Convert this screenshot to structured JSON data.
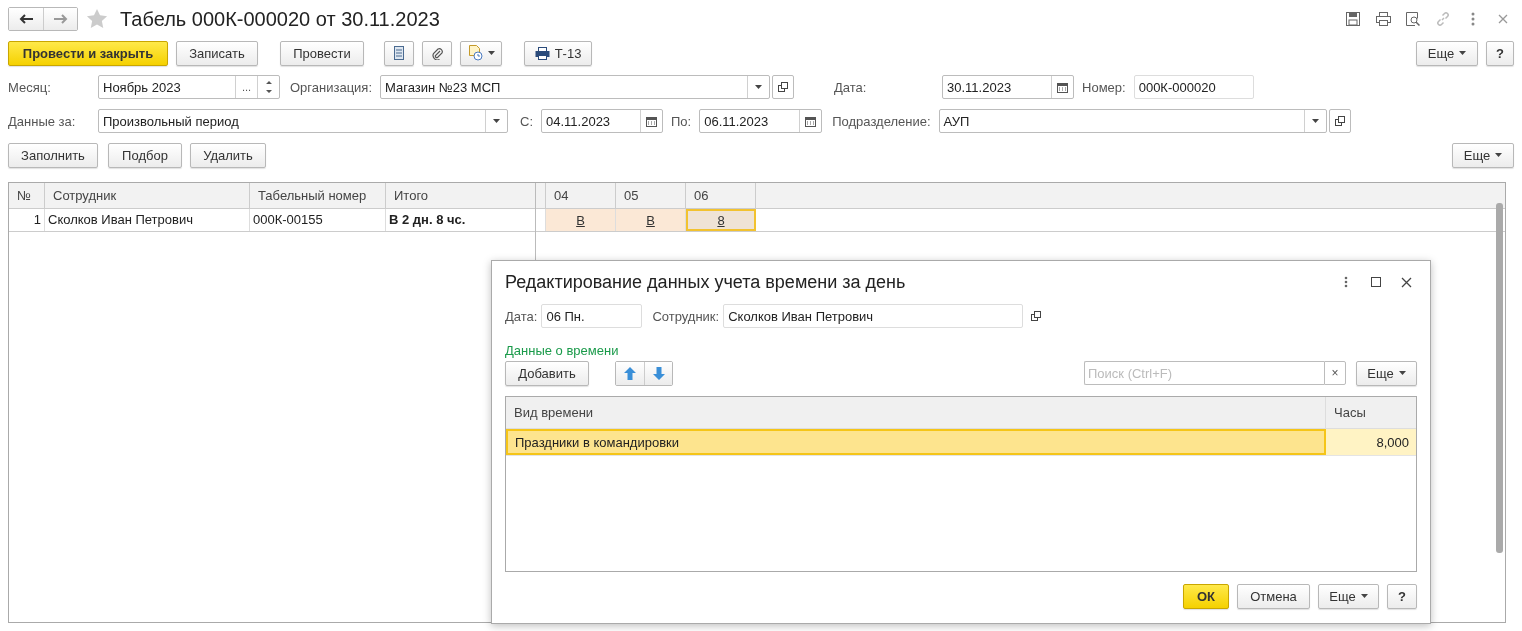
{
  "window": {
    "title": "Табель 000К-000020 от 30.11.2023",
    "favorite": false
  },
  "toolbar": {
    "post_close": "Провести и закрыть",
    "save": "Записать",
    "post": "Провести",
    "print": "Т-13",
    "more": "Еще",
    "help": "?"
  },
  "form": {
    "month_label": "Месяц:",
    "month": "Ноябрь 2023",
    "month_choose": "...",
    "org_label": "Организация:",
    "org": "Магазин №23 МСП",
    "date_label": "Дата:",
    "date": "30.11.2023",
    "number_label": "Номер:",
    "number": "000К-000020",
    "period_label": "Данные за:",
    "period": "Произвольный период",
    "from_label": "С:",
    "from": "04.11.2023",
    "to_label": "По:",
    "to": "06.11.2023",
    "dept_label": "Подразделение:",
    "dept": "АУП"
  },
  "table_buttons": {
    "fill": "Заполнить",
    "pick": "Подбор",
    "delete": "Удалить",
    "more": "Еще"
  },
  "table": {
    "columns": [
      "№",
      "Сотрудник",
      "Табельный номер",
      "Итого"
    ],
    "day_columns": [
      "04",
      "05",
      "06"
    ],
    "rows": [
      {
        "number": "1",
        "employee": "Сколков Иван Петрович",
        "tab_number": "000К-00155",
        "total": "В 2 дн. 8 чс.",
        "days": [
          {
            "value": "В",
            "selected": false
          },
          {
            "value": "В",
            "selected": false
          },
          {
            "value": "8",
            "selected": true
          }
        ]
      }
    ]
  },
  "dialog": {
    "title": "Редактирование данных учета времени за день",
    "date_label": "Дата:",
    "date": "06 Пн.",
    "employee_label": "Сотрудник:",
    "employee": "Сколков Иван Петрович",
    "section": "Данные о времени",
    "add": "Добавить",
    "search": {
      "placeholder": "Поиск (Ctrl+F)"
    },
    "clear": "×",
    "more": "Еще",
    "columns": [
      "Вид времени",
      "Часы"
    ],
    "rows": [
      {
        "kind_of_time": "Праздники в командировки",
        "hours": "8,000",
        "selected": true
      }
    ],
    "ok": "ОК",
    "cancel": "Отмена",
    "footer_more": "Еще",
    "help": "?"
  }
}
